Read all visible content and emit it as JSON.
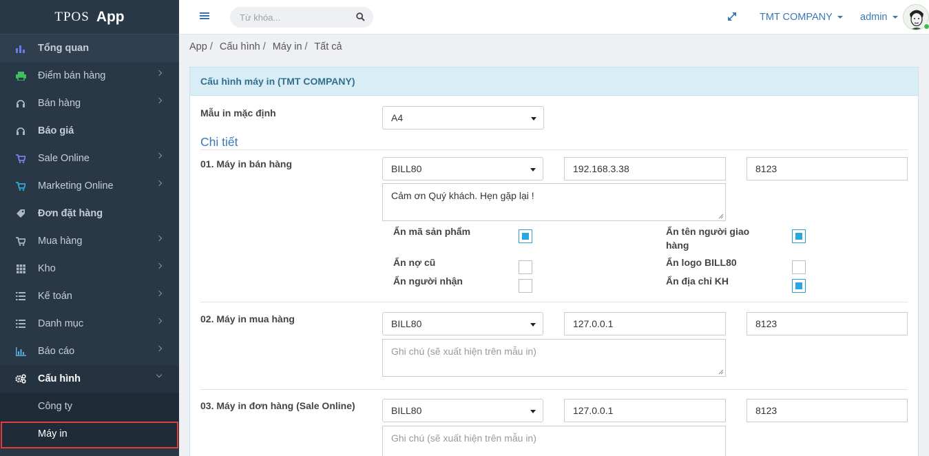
{
  "brand": {
    "part1": "TPOS",
    "part2": "App"
  },
  "sidebar": {
    "items": [
      {
        "label": "Tổng quan",
        "icon": "bar-chart-icon"
      },
      {
        "label": "Điểm bán hàng",
        "icon": "printer-icon"
      },
      {
        "label": "Bán hàng",
        "icon": "headset-icon"
      },
      {
        "label": "Báo giá",
        "icon": "headset-icon"
      },
      {
        "label": "Sale Online",
        "icon": "cart-icon"
      },
      {
        "label": "Marketing Online",
        "icon": "cart-icon"
      },
      {
        "label": "Đơn đặt hàng",
        "icon": "tag-icon"
      },
      {
        "label": "Mua hàng",
        "icon": "cart-icon"
      },
      {
        "label": "Kho",
        "icon": "grid-icon"
      },
      {
        "label": "Kế toán",
        "icon": "list-icon"
      },
      {
        "label": "Danh mục",
        "icon": "list-icon"
      },
      {
        "label": "Báo cáo",
        "icon": "report-icon"
      },
      {
        "label": "Cấu hình",
        "icon": "gears-icon"
      }
    ],
    "sub_items": [
      {
        "label": "Công ty"
      },
      {
        "label": "Máy in"
      }
    ]
  },
  "topbar": {
    "search_placeholder": "Từ khóa...",
    "company": "TMT COMPANY",
    "user": "admin"
  },
  "breadcrumb": [
    "App",
    "Cấu hình",
    "Máy in",
    "Tất cả"
  ],
  "panel": {
    "title": "Cấu hình máy in (TMT COMPANY)",
    "default_template_label": "Mẫu in mặc định",
    "default_template_value": "A4",
    "section_title": "Chi tiết",
    "printers": [
      {
        "label": "01. Máy in bán hàng",
        "template": "BILL80",
        "ip": "192.168.3.38",
        "port": "8123",
        "note": "Cảm ơn Quý khách. Hẹn gặp lại !",
        "options": [
          {
            "label": "Ẩn mã sản phẩm",
            "checked": true
          },
          {
            "label": "Ẩn tên người giao hàng",
            "checked": true
          },
          {
            "label": "Ẩn nợ cũ",
            "checked": false
          },
          {
            "label": "Ẩn logo BILL80",
            "checked": false
          },
          {
            "label": "Ẩn người nhận",
            "checked": false
          },
          {
            "label": "Ẩn địa chỉ KH",
            "checked": true
          }
        ]
      },
      {
        "label": "02. Máy in mua hàng",
        "template": "BILL80",
        "ip": "127.0.0.1",
        "port": "8123",
        "note_placeholder": "Ghi chú (sẽ xuất hiện trên mẫu in)"
      },
      {
        "label": "03. Máy in đơn hàng (Sale Online)",
        "template": "BILL80",
        "ip": "127.0.0.1",
        "port": "8123",
        "note_placeholder": "Ghi chú (sẽ xuất hiện trên mẫu in)"
      }
    ]
  },
  "colors": {
    "sidebar_bg": "#293846",
    "accent": "#3b78b8",
    "checkbox_on": "#2aa6e0",
    "highlight_box": "#e23d3d"
  }
}
